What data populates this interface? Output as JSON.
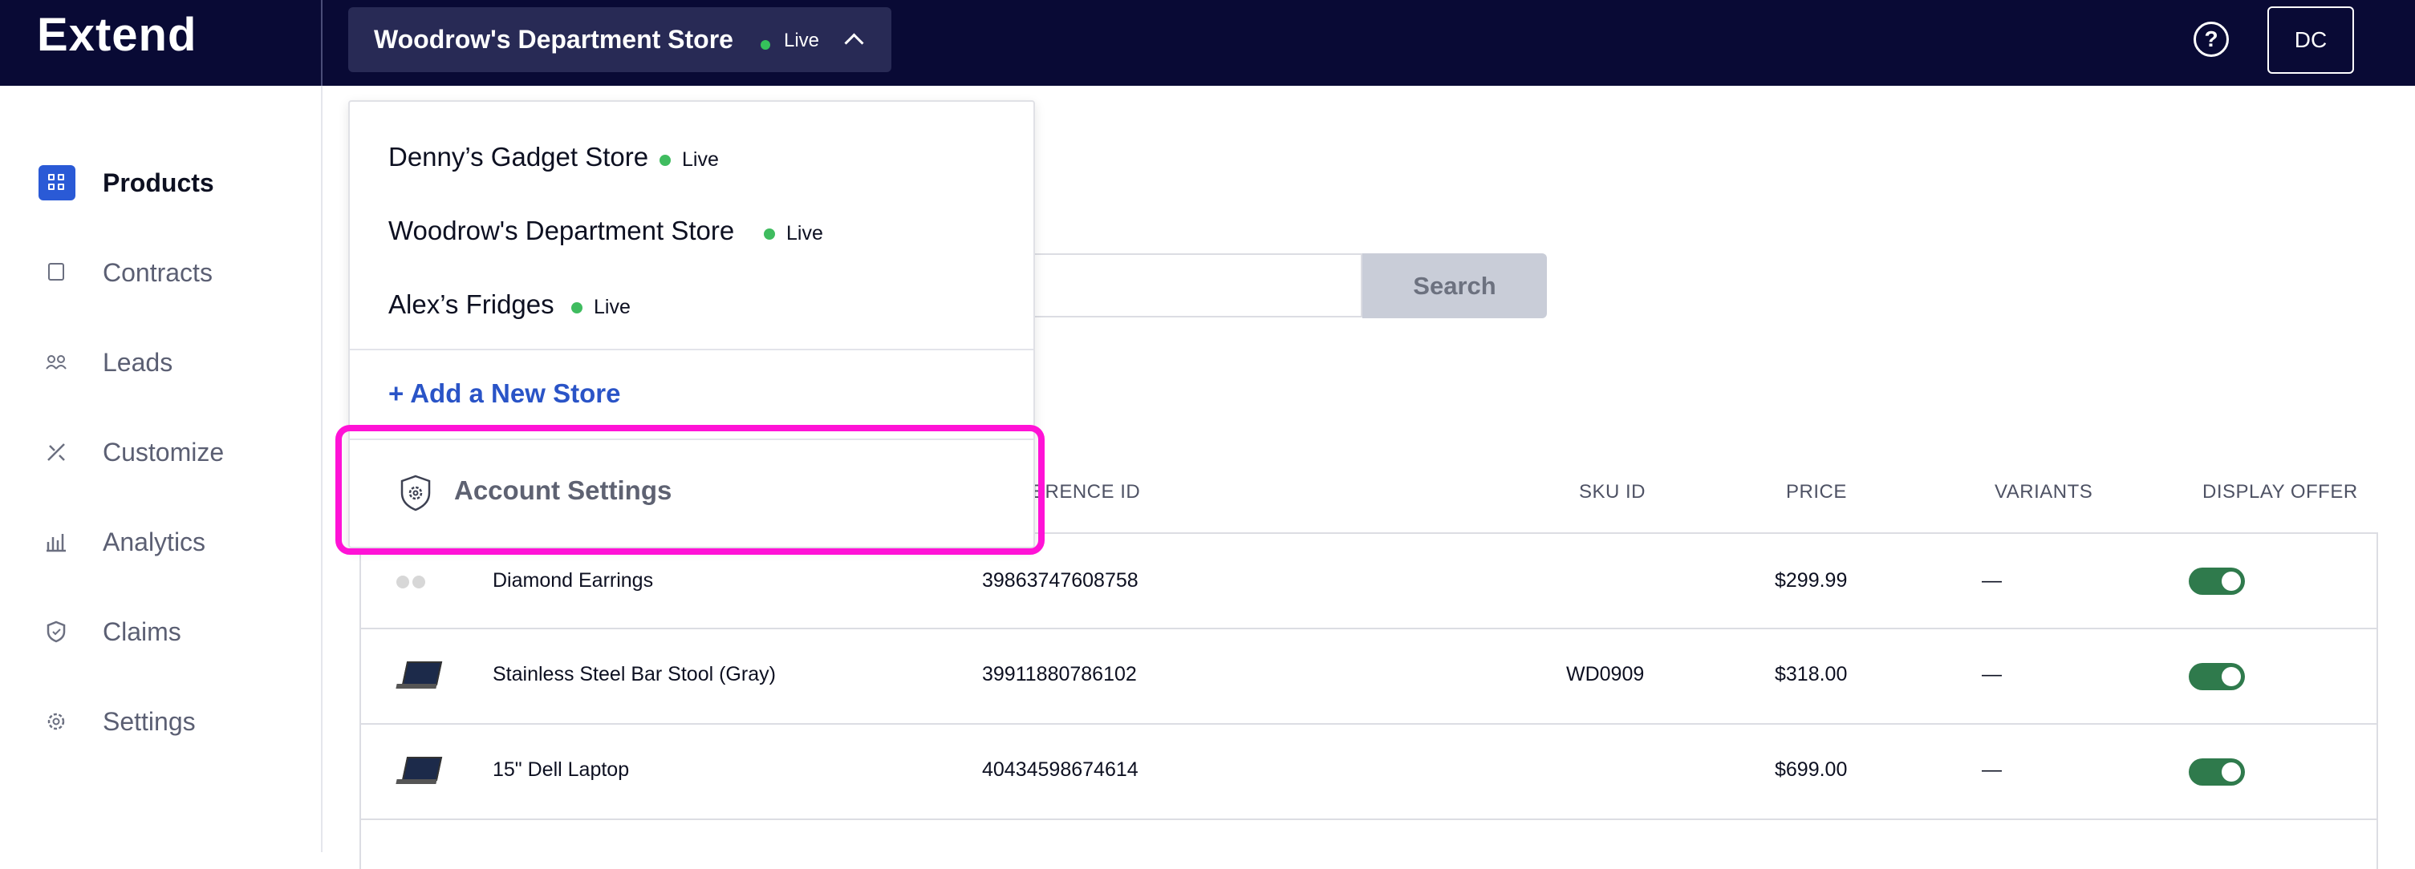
{
  "brand": {
    "name": "Extend"
  },
  "header": {
    "current_store": "Woodrow's Department Store",
    "current_status": "Live",
    "help_label": "?",
    "avatar_initials": "DC"
  },
  "sidebar": {
    "items": [
      {
        "label": "Products",
        "icon": "grid-icon",
        "active": true
      },
      {
        "label": "Contracts",
        "icon": "contracts-icon"
      },
      {
        "label": "Leads",
        "icon": "leads-icon"
      },
      {
        "label": "Customize",
        "icon": "customize-icon"
      },
      {
        "label": "Analytics",
        "icon": "analytics-icon"
      },
      {
        "label": "Claims",
        "icon": "shield-icon"
      },
      {
        "label": "Settings",
        "icon": "gear-icon"
      }
    ]
  },
  "search": {
    "button_label": "Search"
  },
  "table": {
    "headers": {
      "reference": "ERENCE ID",
      "sku": "SKU ID",
      "price": "PRICE",
      "variants": "VARIANTS",
      "display": "DISPLAY OFFER"
    },
    "rows": [
      {
        "name": "Diamond Earrings",
        "reference": "39863747608758",
        "sku": "",
        "price": "$299.99",
        "variants": "—",
        "display_offer": true
      },
      {
        "name": "Stainless Steel Bar Stool (Gray)",
        "reference": "39911880786102",
        "sku": "WD0909",
        "price": "$318.00",
        "variants": "—",
        "display_offer": true
      },
      {
        "name": "15\" Dell Laptop",
        "reference": "40434598674614",
        "sku": "",
        "price": "$699.00",
        "variants": "—",
        "display_offer": true
      }
    ]
  },
  "dropdown": {
    "stores": [
      {
        "name": "Denny’s Gadget Store",
        "status": "Live"
      },
      {
        "name": "Woodrow's Department Store",
        "status": "Live"
      },
      {
        "name": "Alex’s Fridges",
        "status": "Live"
      }
    ],
    "add_store_label": "+ Add a New Store",
    "account_settings_label": "Account Settings"
  },
  "colors": {
    "topbar": "#090a35",
    "accent": "#2a54c7",
    "live": "#3fbc5f",
    "highlight": "#ff12d6",
    "toggle": "#2f7a4c"
  }
}
